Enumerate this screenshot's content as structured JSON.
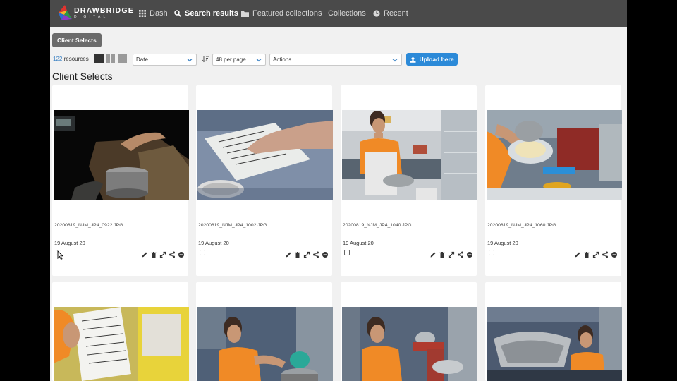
{
  "header": {
    "logo_text": "DRAWBRIDGE",
    "logo_sub": "DIGITAL",
    "nav": [
      {
        "label": "Dash",
        "icon": "grid-icon"
      },
      {
        "label": "Search results",
        "icon": "search-icon",
        "active": true
      },
      {
        "label": "Featured collections",
        "icon": "folder-icon"
      },
      {
        "label": "Collections",
        "icon": ""
      },
      {
        "label": "Recent",
        "icon": "clock-icon"
      }
    ]
  },
  "toolbar": {
    "collection_chip": "Client Selects",
    "resource_count": "122",
    "resource_label": " resources",
    "sort_select": "Date",
    "per_page_select": "48 per page",
    "actions_select": "Actions...",
    "upload_label": "Upload here"
  },
  "page_title": "Client Selects",
  "colors": {
    "accent": "#2c8ad8",
    "header": "#4a4a4a",
    "background": "#f1f1f1"
  },
  "resources": [
    {
      "filename": "20200819_NJM_JP4_0922.JPG",
      "date": "19 August 20",
      "subject": "pot-on-scale"
    },
    {
      "filename": "20200819_NJM_JP4_1002.JPG",
      "date": "19 August 20",
      "subject": "handwritten-notebook"
    },
    {
      "filename": "20200819_NJM_JP4_1040.JPG",
      "date": "19 August 20",
      "subject": "woman-mixing-bowl"
    },
    {
      "filename": "20200819_NJM_JP4_1060.JPG",
      "date": "19 August 20",
      "subject": "dough-in-bowl"
    },
    {
      "filename": "",
      "date": "",
      "subject": "recipe-sheet"
    },
    {
      "filename": "",
      "date": "",
      "subject": "woman-stirring-pot"
    },
    {
      "filename": "",
      "date": "",
      "subject": "woman-with-mixer"
    },
    {
      "filename": "",
      "date": "",
      "subject": "woman-lifting-lid"
    }
  ]
}
